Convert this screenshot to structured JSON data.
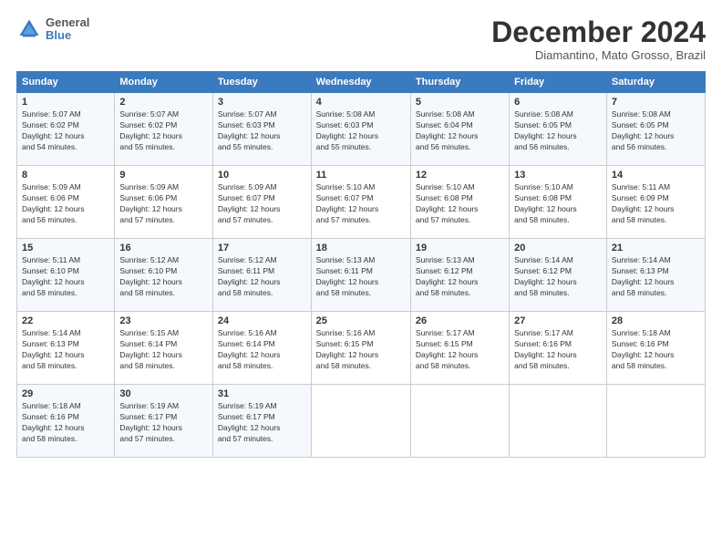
{
  "header": {
    "logo": {
      "line1": "General",
      "line2": "Blue"
    },
    "title": "December 2024",
    "location": "Diamantino, Mato Grosso, Brazil"
  },
  "columns": [
    "Sunday",
    "Monday",
    "Tuesday",
    "Wednesday",
    "Thursday",
    "Friday",
    "Saturday"
  ],
  "weeks": [
    [
      {
        "day": 1,
        "lines": [
          "Sunrise: 5:07 AM",
          "Sunset: 6:02 PM",
          "Daylight: 12 hours",
          "and 54 minutes."
        ]
      },
      {
        "day": 2,
        "lines": [
          "Sunrise: 5:07 AM",
          "Sunset: 6:02 PM",
          "Daylight: 12 hours",
          "and 55 minutes."
        ]
      },
      {
        "day": 3,
        "lines": [
          "Sunrise: 5:07 AM",
          "Sunset: 6:03 PM",
          "Daylight: 12 hours",
          "and 55 minutes."
        ]
      },
      {
        "day": 4,
        "lines": [
          "Sunrise: 5:08 AM",
          "Sunset: 6:03 PM",
          "Daylight: 12 hours",
          "and 55 minutes."
        ]
      },
      {
        "day": 5,
        "lines": [
          "Sunrise: 5:08 AM",
          "Sunset: 6:04 PM",
          "Daylight: 12 hours",
          "and 56 minutes."
        ]
      },
      {
        "day": 6,
        "lines": [
          "Sunrise: 5:08 AM",
          "Sunset: 6:05 PM",
          "Daylight: 12 hours",
          "and 56 minutes."
        ]
      },
      {
        "day": 7,
        "lines": [
          "Sunrise: 5:08 AM",
          "Sunset: 6:05 PM",
          "Daylight: 12 hours",
          "and 56 minutes."
        ]
      }
    ],
    [
      {
        "day": 8,
        "lines": [
          "Sunrise: 5:09 AM",
          "Sunset: 6:06 PM",
          "Daylight: 12 hours",
          "and 56 minutes."
        ]
      },
      {
        "day": 9,
        "lines": [
          "Sunrise: 5:09 AM",
          "Sunset: 6:06 PM",
          "Daylight: 12 hours",
          "and 57 minutes."
        ]
      },
      {
        "day": 10,
        "lines": [
          "Sunrise: 5:09 AM",
          "Sunset: 6:07 PM",
          "Daylight: 12 hours",
          "and 57 minutes."
        ]
      },
      {
        "day": 11,
        "lines": [
          "Sunrise: 5:10 AM",
          "Sunset: 6:07 PM",
          "Daylight: 12 hours",
          "and 57 minutes."
        ]
      },
      {
        "day": 12,
        "lines": [
          "Sunrise: 5:10 AM",
          "Sunset: 6:08 PM",
          "Daylight: 12 hours",
          "and 57 minutes."
        ]
      },
      {
        "day": 13,
        "lines": [
          "Sunrise: 5:10 AM",
          "Sunset: 6:08 PM",
          "Daylight: 12 hours",
          "and 58 minutes."
        ]
      },
      {
        "day": 14,
        "lines": [
          "Sunrise: 5:11 AM",
          "Sunset: 6:09 PM",
          "Daylight: 12 hours",
          "and 58 minutes."
        ]
      }
    ],
    [
      {
        "day": 15,
        "lines": [
          "Sunrise: 5:11 AM",
          "Sunset: 6:10 PM",
          "Daylight: 12 hours",
          "and 58 minutes."
        ]
      },
      {
        "day": 16,
        "lines": [
          "Sunrise: 5:12 AM",
          "Sunset: 6:10 PM",
          "Daylight: 12 hours",
          "and 58 minutes."
        ]
      },
      {
        "day": 17,
        "lines": [
          "Sunrise: 5:12 AM",
          "Sunset: 6:11 PM",
          "Daylight: 12 hours",
          "and 58 minutes."
        ]
      },
      {
        "day": 18,
        "lines": [
          "Sunrise: 5:13 AM",
          "Sunset: 6:11 PM",
          "Daylight: 12 hours",
          "and 58 minutes."
        ]
      },
      {
        "day": 19,
        "lines": [
          "Sunrise: 5:13 AM",
          "Sunset: 6:12 PM",
          "Daylight: 12 hours",
          "and 58 minutes."
        ]
      },
      {
        "day": 20,
        "lines": [
          "Sunrise: 5:14 AM",
          "Sunset: 6:12 PM",
          "Daylight: 12 hours",
          "and 58 minutes."
        ]
      },
      {
        "day": 21,
        "lines": [
          "Sunrise: 5:14 AM",
          "Sunset: 6:13 PM",
          "Daylight: 12 hours",
          "and 58 minutes."
        ]
      }
    ],
    [
      {
        "day": 22,
        "lines": [
          "Sunrise: 5:14 AM",
          "Sunset: 6:13 PM",
          "Daylight: 12 hours",
          "and 58 minutes."
        ]
      },
      {
        "day": 23,
        "lines": [
          "Sunrise: 5:15 AM",
          "Sunset: 6:14 PM",
          "Daylight: 12 hours",
          "and 58 minutes."
        ]
      },
      {
        "day": 24,
        "lines": [
          "Sunrise: 5:16 AM",
          "Sunset: 6:14 PM",
          "Daylight: 12 hours",
          "and 58 minutes."
        ]
      },
      {
        "day": 25,
        "lines": [
          "Sunrise: 5:16 AM",
          "Sunset: 6:15 PM",
          "Daylight: 12 hours",
          "and 58 minutes."
        ]
      },
      {
        "day": 26,
        "lines": [
          "Sunrise: 5:17 AM",
          "Sunset: 6:15 PM",
          "Daylight: 12 hours",
          "and 58 minutes."
        ]
      },
      {
        "day": 27,
        "lines": [
          "Sunrise: 5:17 AM",
          "Sunset: 6:16 PM",
          "Daylight: 12 hours",
          "and 58 minutes."
        ]
      },
      {
        "day": 28,
        "lines": [
          "Sunrise: 5:18 AM",
          "Sunset: 6:16 PM",
          "Daylight: 12 hours",
          "and 58 minutes."
        ]
      }
    ],
    [
      {
        "day": 29,
        "lines": [
          "Sunrise: 5:18 AM",
          "Sunset: 6:16 PM",
          "Daylight: 12 hours",
          "and 58 minutes."
        ]
      },
      {
        "day": 30,
        "lines": [
          "Sunrise: 5:19 AM",
          "Sunset: 6:17 PM",
          "Daylight: 12 hours",
          "and 57 minutes."
        ]
      },
      {
        "day": 31,
        "lines": [
          "Sunrise: 5:19 AM",
          "Sunset: 6:17 PM",
          "Daylight: 12 hours",
          "and 57 minutes."
        ]
      },
      null,
      null,
      null,
      null
    ]
  ]
}
